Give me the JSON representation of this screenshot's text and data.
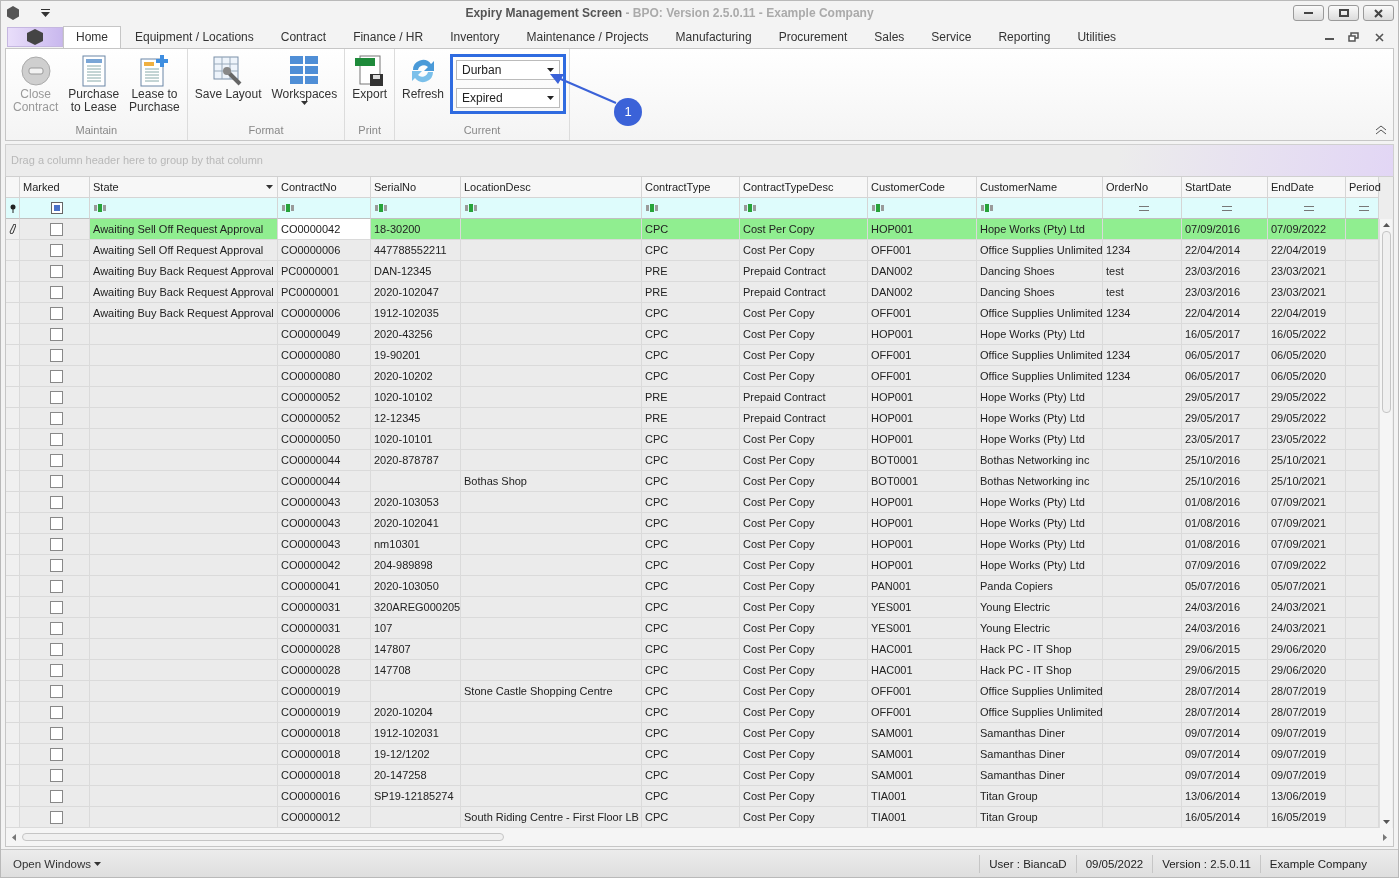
{
  "window": {
    "title": "Expiry Management Screen",
    "subtitle": " - BPO: Version 2.5.0.11 - Example Company"
  },
  "tabs": [
    {
      "label": "Home",
      "selected": true
    },
    {
      "label": "Equipment / Locations",
      "selected": false
    },
    {
      "label": "Contract",
      "selected": false
    },
    {
      "label": "Finance / HR",
      "selected": false
    },
    {
      "label": "Inventory",
      "selected": false
    },
    {
      "label": "Maintenance / Projects",
      "selected": false
    },
    {
      "label": "Manufacturing",
      "selected": false
    },
    {
      "label": "Procurement",
      "selected": false
    },
    {
      "label": "Sales",
      "selected": false
    },
    {
      "label": "Service",
      "selected": false
    },
    {
      "label": "Reporting",
      "selected": false
    },
    {
      "label": "Utilities",
      "selected": false
    }
  ],
  "ribbon": {
    "groups": [
      {
        "label": "Maintain",
        "buttons": [
          {
            "kind": "close",
            "lines": [
              "Close",
              "Contract"
            ],
            "disabled": true
          },
          {
            "kind": "doc",
            "lines": [
              "Purchase",
              "to Lease"
            ],
            "disabled": false
          },
          {
            "kind": "docplus",
            "lines": [
              "Lease to",
              "Purchase"
            ],
            "disabled": false
          }
        ]
      },
      {
        "label": "Format",
        "buttons": [
          {
            "kind": "layout",
            "lines": [
              "Save Layout"
            ],
            "disabled": false
          },
          {
            "kind": "grid",
            "lines": [
              "Workspaces"
            ],
            "disabled": false,
            "dropdown": true
          }
        ]
      },
      {
        "label": "Print",
        "buttons": [
          {
            "kind": "xlsx",
            "lines": [
              "Export"
            ],
            "disabled": false
          }
        ]
      },
      {
        "label": "Current",
        "buttons": [
          {
            "kind": "refresh",
            "lines": [
              "Refresh"
            ],
            "disabled": false
          }
        ],
        "selects": [
          "Durban",
          "Expired"
        ],
        "callout": "1"
      }
    ]
  },
  "group_panel": {
    "placeholder": "Drag a column header here to group by that column"
  },
  "columns": [
    "Marked",
    "State",
    "ContractNo",
    "SerialNo",
    "LocationDesc",
    "ContractType",
    "ContractTypeDesc",
    "CustomerCode",
    "CustomerName",
    "OrderNo",
    "StartDate",
    "EndDate",
    "Period"
  ],
  "rows": [
    {
      "selected": true,
      "checked": false,
      "cells": [
        "Awaiting Sell Off Request Approval",
        "CO0000042",
        "18-30200",
        null,
        "CPC",
        "Cost Per Copy",
        "HOP001",
        "Hope Works (Pty) Ltd",
        null,
        "07/09/2016",
        "07/09/2022"
      ]
    },
    {
      "selected": false,
      "checked": false,
      "cells": [
        "Awaiting Sell Off Request Approval",
        "CO0000006",
        "447788552211",
        null,
        "CPC",
        "Cost Per Copy",
        "OFF001",
        "Office Supplies Unlimited",
        "1234",
        "22/04/2014",
        "22/04/2019"
      ]
    },
    {
      "selected": false,
      "checked": false,
      "cells": [
        "Awaiting Buy Back Request Approval",
        "PC0000001",
        "DAN-12345",
        null,
        "PRE",
        "Prepaid Contract",
        "DAN002",
        "Dancing Shoes",
        "test",
        "23/03/2016",
        "23/03/2021"
      ]
    },
    {
      "selected": false,
      "checked": false,
      "cells": [
        "Awaiting Buy Back Request Approval",
        "PC0000001",
        "2020-102047",
        null,
        "PRE",
        "Prepaid Contract",
        "DAN002",
        "Dancing Shoes",
        "test",
        "23/03/2016",
        "23/03/2021"
      ]
    },
    {
      "selected": false,
      "checked": false,
      "cells": [
        "Awaiting Buy Back Request Approval",
        "CO0000006",
        "1912-102035",
        null,
        "CPC",
        "Cost Per Copy",
        "OFF001",
        "Office Supplies Unlimited",
        "1234",
        "22/04/2014",
        "22/04/2019"
      ]
    },
    {
      "selected": false,
      "checked": false,
      "cells": [
        null,
        "CO0000049",
        "2020-43256",
        null,
        "CPC",
        "Cost Per Copy",
        "HOP001",
        "Hope Works (Pty) Ltd",
        null,
        "16/05/2017",
        "16/05/2022"
      ]
    },
    {
      "selected": false,
      "checked": false,
      "cells": [
        null,
        "CO0000080",
        "19-90201",
        null,
        "CPC",
        "Cost Per Copy",
        "OFF001",
        "Office Supplies Unlimited",
        "1234",
        "06/05/2017",
        "06/05/2020"
      ]
    },
    {
      "selected": false,
      "checked": false,
      "cells": [
        null,
        "CO0000080",
        "2020-10202",
        null,
        "CPC",
        "Cost Per Copy",
        "OFF001",
        "Office Supplies Unlimited",
        "1234",
        "06/05/2017",
        "06/05/2020"
      ]
    },
    {
      "selected": false,
      "checked": false,
      "cells": [
        null,
        "CO0000052",
        "1020-10102",
        null,
        "PRE",
        "Prepaid Contract",
        "HOP001",
        "Hope Works (Pty) Ltd",
        null,
        "29/05/2017",
        "29/05/2022"
      ]
    },
    {
      "selected": false,
      "checked": false,
      "cells": [
        null,
        "CO0000052",
        "12-12345",
        null,
        "PRE",
        "Prepaid Contract",
        "HOP001",
        "Hope Works (Pty) Ltd",
        null,
        "29/05/2017",
        "29/05/2022"
      ]
    },
    {
      "selected": false,
      "checked": false,
      "cells": [
        null,
        "CO0000050",
        "1020-10101",
        null,
        "CPC",
        "Cost Per Copy",
        "HOP001",
        "Hope Works (Pty) Ltd",
        null,
        "23/05/2017",
        "23/05/2022"
      ]
    },
    {
      "selected": false,
      "checked": false,
      "cells": [
        null,
        "CO0000044",
        "2020-878787",
        null,
        "CPC",
        "Cost Per Copy",
        "BOT0001",
        "Bothas Networking inc",
        null,
        "25/10/2016",
        "25/10/2021"
      ]
    },
    {
      "selected": false,
      "checked": false,
      "cells": [
        null,
        "CO0000044",
        null,
        "Bothas Shop",
        "CPC",
        "Cost Per Copy",
        "BOT0001",
        "Bothas Networking inc",
        null,
        "25/10/2016",
        "25/10/2021"
      ]
    },
    {
      "selected": false,
      "checked": false,
      "cells": [
        null,
        "CO0000043",
        "2020-103053",
        null,
        "CPC",
        "Cost Per Copy",
        "HOP001",
        "Hope Works (Pty) Ltd",
        null,
        "01/08/2016",
        "07/09/2021"
      ]
    },
    {
      "selected": false,
      "checked": false,
      "cells": [
        null,
        "CO0000043",
        "2020-102041",
        null,
        "CPC",
        "Cost Per Copy",
        "HOP001",
        "Hope Works (Pty) Ltd",
        null,
        "01/08/2016",
        "07/09/2021"
      ]
    },
    {
      "selected": false,
      "checked": false,
      "cells": [
        null,
        "CO0000043",
        "nm10301",
        null,
        "CPC",
        "Cost Per Copy",
        "HOP001",
        "Hope Works (Pty) Ltd",
        null,
        "01/08/2016",
        "07/09/2021"
      ]
    },
    {
      "selected": false,
      "checked": false,
      "cells": [
        null,
        "CO0000042",
        "204-989898",
        null,
        "CPC",
        "Cost Per Copy",
        "HOP001",
        "Hope Works (Pty) Ltd",
        null,
        "07/09/2016",
        "07/09/2022"
      ]
    },
    {
      "selected": false,
      "checked": false,
      "cells": [
        null,
        "CO0000041",
        "2020-103050",
        null,
        "CPC",
        "Cost Per Copy",
        "PAN001",
        "Panda Copiers",
        null,
        "05/07/2016",
        "05/07/2021"
      ]
    },
    {
      "selected": false,
      "checked": false,
      "cells": [
        null,
        "CO0000031",
        "320AREG000205",
        null,
        "CPC",
        "Cost Per Copy",
        "YES001",
        "Young Electric",
        null,
        "24/03/2016",
        "24/03/2021"
      ]
    },
    {
      "selected": false,
      "checked": false,
      "cells": [
        null,
        "CO0000031",
        "107",
        null,
        "CPC",
        "Cost Per Copy",
        "YES001",
        "Young Electric",
        null,
        "24/03/2016",
        "24/03/2021"
      ]
    },
    {
      "selected": false,
      "checked": false,
      "cells": [
        null,
        "CO0000028",
        "147807",
        null,
        "CPC",
        "Cost Per Copy",
        "HAC001",
        "Hack PC - IT Shop",
        null,
        "29/06/2015",
        "29/06/2020"
      ]
    },
    {
      "selected": false,
      "checked": false,
      "cells": [
        null,
        "CO0000028",
        "147708",
        null,
        "CPC",
        "Cost Per Copy",
        "HAC001",
        "Hack PC - IT Shop",
        null,
        "29/06/2015",
        "29/06/2020"
      ]
    },
    {
      "selected": false,
      "checked": false,
      "cells": [
        null,
        "CO0000019",
        null,
        "Stone Castle Shopping Centre",
        "CPC",
        "Cost Per Copy",
        "OFF001",
        "Office Supplies Unlimited",
        null,
        "28/07/2014",
        "28/07/2019"
      ]
    },
    {
      "selected": false,
      "checked": false,
      "cells": [
        null,
        "CO0000019",
        "2020-10204",
        null,
        "CPC",
        "Cost Per Copy",
        "OFF001",
        "Office Supplies Unlimited",
        null,
        "28/07/2014",
        "28/07/2019"
      ]
    },
    {
      "selected": false,
      "checked": false,
      "cells": [
        null,
        "CO0000018",
        "1912-102031",
        null,
        "CPC",
        "Cost Per Copy",
        "SAM001",
        "Samanthas Diner",
        null,
        "09/07/2014",
        "09/07/2019"
      ]
    },
    {
      "selected": false,
      "checked": false,
      "cells": [
        null,
        "CO0000018",
        "19-12/1202",
        null,
        "CPC",
        "Cost Per Copy",
        "SAM001",
        "Samanthas Diner",
        null,
        "09/07/2014",
        "09/07/2019"
      ]
    },
    {
      "selected": false,
      "checked": false,
      "cells": [
        null,
        "CO0000018",
        "20-147258",
        null,
        "CPC",
        "Cost Per Copy",
        "SAM001",
        "Samanthas Diner",
        null,
        "09/07/2014",
        "09/07/2019"
      ]
    },
    {
      "selected": false,
      "checked": false,
      "cells": [
        null,
        "CO0000016",
        "SP19-12185274",
        null,
        "CPC",
        "Cost Per Copy",
        "TIA001",
        "Titan Group",
        null,
        "13/06/2014",
        "13/06/2019"
      ]
    },
    {
      "selected": false,
      "checked": false,
      "cells": [
        null,
        "CO0000012",
        null,
        "South Riding Centre - First Floor LB",
        "CPC",
        "Cost Per Copy",
        "TIA001",
        "Titan Group",
        null,
        "16/05/2014",
        "16/05/2019"
      ]
    }
  ],
  "status_bar": {
    "menu": "Open Windows",
    "items": [
      "User : BiancaD",
      "09/05/2022",
      "Version : 2.5.0.11",
      "Example Company"
    ]
  }
}
